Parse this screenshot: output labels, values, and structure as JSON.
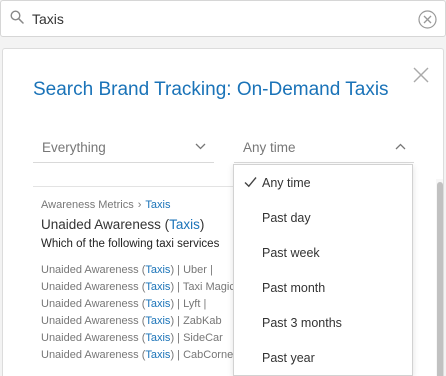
{
  "search": {
    "value": "Taxis"
  },
  "panel": {
    "title": "Search Brand Tracking: On-Demand Taxis",
    "filters": {
      "scope": "Everything",
      "time": "Any time"
    }
  },
  "result": {
    "breadcrumb": {
      "parent": "Awareness Metrics",
      "current": "Taxis"
    },
    "title_prefix": "Unaided Awareness (",
    "title_highlight": "Taxis",
    "title_suffix": ")",
    "question": "Which of the following taxi services",
    "rows": [
      {
        "prefix": "Unaided Awareness (",
        "hl": "Taxis",
        "suffix": ") | Uber  |"
      },
      {
        "prefix": "Unaided Awareness (",
        "hl": "Taxis",
        "suffix": ") | Taxi Magic"
      },
      {
        "prefix": "Unaided Awareness (",
        "hl": "Taxis",
        "suffix": ") | Lyft  |"
      },
      {
        "prefix": "Unaided Awareness (",
        "hl": "Taxis",
        "suffix": ") | ZabKab"
      },
      {
        "prefix": "Unaided Awareness (",
        "hl": "Taxis",
        "suffix": ") | SideCar"
      },
      {
        "prefix": "Unaided Awareness (",
        "hl": "Taxis",
        "suffix": ") | CabCorner"
      }
    ]
  },
  "dropdown": {
    "options": [
      "Any time",
      "Past day",
      "Past week",
      "Past month",
      "Past 3 months",
      "Past year"
    ],
    "selected": "Any time"
  },
  "colors": {
    "accent": "#1a73b8",
    "muted": "#777777",
    "border": "#d9d9d9"
  },
  "icons": {
    "search": "search-icon",
    "clear": "clear-icon",
    "close": "close-icon",
    "chevron": "chevron-down-icon",
    "check": "check-icon"
  }
}
